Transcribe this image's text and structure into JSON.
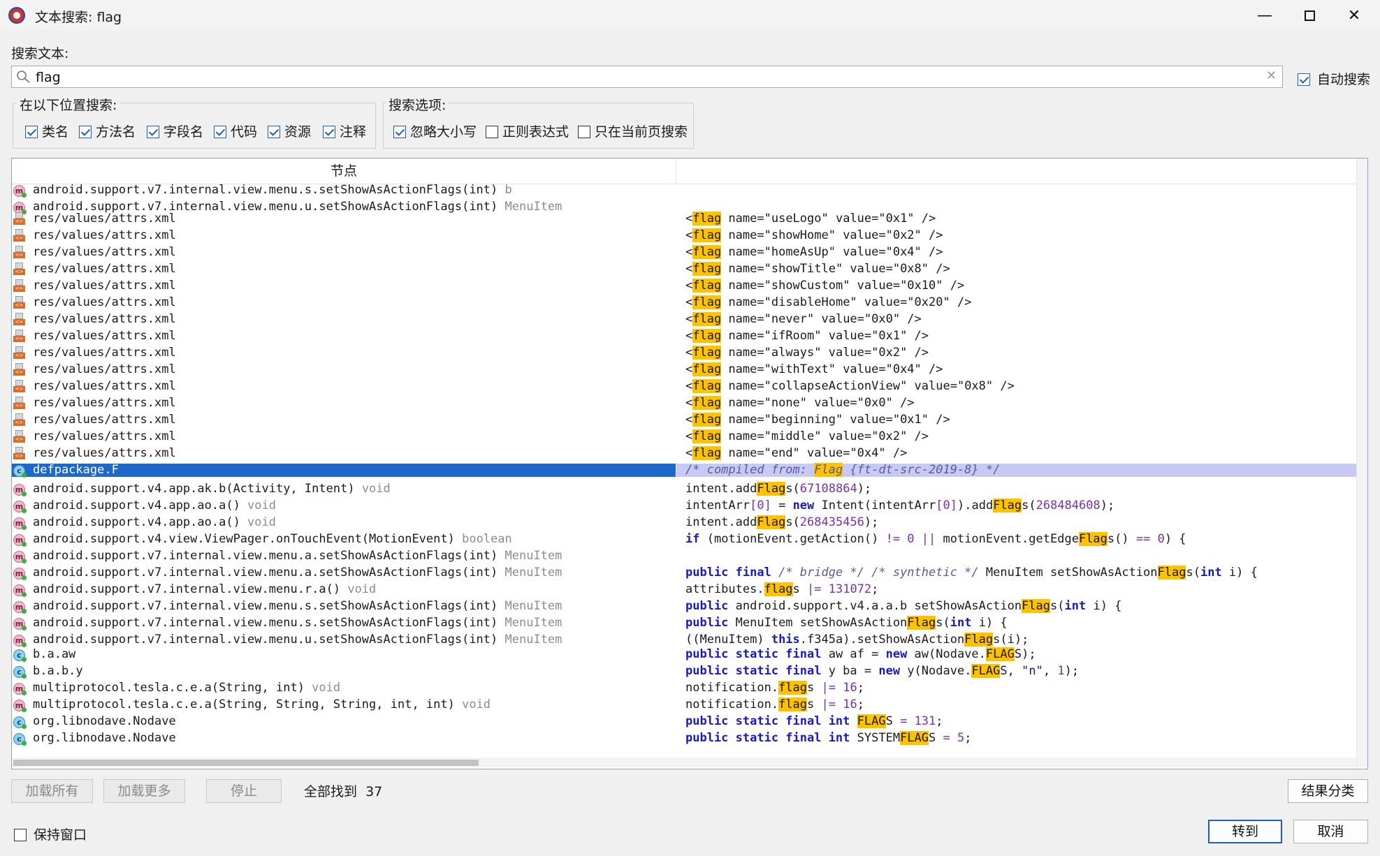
{
  "window": {
    "title": "文本搜索: flag"
  },
  "search": {
    "label": "搜索文本:",
    "value": "flag",
    "auto_search_label": "自动搜索",
    "auto_search_checked": true
  },
  "location_group": {
    "title": "在以下位置搜索:",
    "options": [
      {
        "label": "类名",
        "checked": true
      },
      {
        "label": "方法名",
        "checked": true
      },
      {
        "label": "字段名",
        "checked": true
      },
      {
        "label": "代码",
        "checked": true
      },
      {
        "label": "资源",
        "checked": true
      },
      {
        "label": "注释",
        "checked": true
      }
    ]
  },
  "search_options_group": {
    "title": "搜索选项:",
    "options": [
      {
        "label": "忽略大小写",
        "checked": true
      },
      {
        "label": "正则表达式",
        "checked": false
      },
      {
        "label": "只在当前页搜索",
        "checked": false
      }
    ]
  },
  "results": {
    "columns": [
      "节点",
      ""
    ],
    "rows": [
      {
        "icon": "method-icon",
        "node": "android.support.v7.internal.view.menu.s.setShowAsActionFlags(int)",
        "ret": "b",
        "code": []
      },
      {
        "icon": "method-icon",
        "node": "android.support.v7.internal.view.menu.u.setShowAsActionFlags(int)",
        "ret": "MenuItem",
        "code": []
      },
      {
        "icon": "xml-resource-icon",
        "node": "res/values/attrs.xml",
        "ret": "",
        "code": [
          [
            "t",
            "<"
          ],
          [
            "h",
            "flag"
          ],
          [
            "t",
            " name=\"useLogo\" value=\"0x1\" />"
          ]
        ]
      },
      {
        "icon": "xml-resource-icon",
        "node": "res/values/attrs.xml",
        "ret": "",
        "code": [
          [
            "t",
            "<"
          ],
          [
            "h",
            "flag"
          ],
          [
            "t",
            " name=\"showHome\" value=\"0x2\" />"
          ]
        ]
      },
      {
        "icon": "xml-resource-icon",
        "node": "res/values/attrs.xml",
        "ret": "",
        "code": [
          [
            "t",
            "<"
          ],
          [
            "h",
            "flag"
          ],
          [
            "t",
            " name=\"homeAsUp\" value=\"0x4\" />"
          ]
        ]
      },
      {
        "icon": "xml-resource-icon",
        "node": "res/values/attrs.xml",
        "ret": "",
        "code": [
          [
            "t",
            "<"
          ],
          [
            "h",
            "flag"
          ],
          [
            "t",
            " name=\"showTitle\" value=\"0x8\" />"
          ]
        ]
      },
      {
        "icon": "xml-resource-icon",
        "node": "res/values/attrs.xml",
        "ret": "",
        "code": [
          [
            "t",
            "<"
          ],
          [
            "h",
            "flag"
          ],
          [
            "t",
            " name=\"showCustom\" value=\"0x10\" />"
          ]
        ]
      },
      {
        "icon": "xml-resource-icon",
        "node": "res/values/attrs.xml",
        "ret": "",
        "code": [
          [
            "t",
            "<"
          ],
          [
            "h",
            "flag"
          ],
          [
            "t",
            " name=\"disableHome\" value=\"0x20\" />"
          ]
        ]
      },
      {
        "icon": "xml-resource-icon",
        "node": "res/values/attrs.xml",
        "ret": "",
        "code": [
          [
            "t",
            "<"
          ],
          [
            "h",
            "flag"
          ],
          [
            "t",
            " name=\"never\" value=\"0x0\" />"
          ]
        ]
      },
      {
        "icon": "xml-resource-icon",
        "node": "res/values/attrs.xml",
        "ret": "",
        "code": [
          [
            "t",
            "<"
          ],
          [
            "h",
            "flag"
          ],
          [
            "t",
            " name=\"ifRoom\" value=\"0x1\" />"
          ]
        ]
      },
      {
        "icon": "xml-resource-icon",
        "node": "res/values/attrs.xml",
        "ret": "",
        "code": [
          [
            "t",
            "<"
          ],
          [
            "h",
            "flag"
          ],
          [
            "t",
            " name=\"always\" value=\"0x2\" />"
          ]
        ]
      },
      {
        "icon": "xml-resource-icon",
        "node": "res/values/attrs.xml",
        "ret": "",
        "code": [
          [
            "t",
            "<"
          ],
          [
            "h",
            "flag"
          ],
          [
            "t",
            " name=\"withText\" value=\"0x4\" />"
          ]
        ]
      },
      {
        "icon": "xml-resource-icon",
        "node": "res/values/attrs.xml",
        "ret": "",
        "code": [
          [
            "t",
            "<"
          ],
          [
            "h",
            "flag"
          ],
          [
            "t",
            " name=\"collapseActionView\" value=\"0x8\" />"
          ]
        ]
      },
      {
        "icon": "xml-resource-icon",
        "node": "res/values/attrs.xml",
        "ret": "",
        "code": [
          [
            "t",
            "<"
          ],
          [
            "h",
            "flag"
          ],
          [
            "t",
            " name=\"none\" value=\"0x0\" />"
          ]
        ]
      },
      {
        "icon": "xml-resource-icon",
        "node": "res/values/attrs.xml",
        "ret": "",
        "code": [
          [
            "t",
            "<"
          ],
          [
            "h",
            "flag"
          ],
          [
            "t",
            " name=\"beginning\" value=\"0x1\" />"
          ]
        ]
      },
      {
        "icon": "xml-resource-icon",
        "node": "res/values/attrs.xml",
        "ret": "",
        "code": [
          [
            "t",
            "<"
          ],
          [
            "h",
            "flag"
          ],
          [
            "t",
            " name=\"middle\" value=\"0x2\" />"
          ]
        ]
      },
      {
        "icon": "xml-resource-icon",
        "node": "res/values/attrs.xml",
        "ret": "",
        "code": [
          [
            "t",
            "<"
          ],
          [
            "h",
            "flag"
          ],
          [
            "t",
            " name=\"end\" value=\"0x4\" />"
          ]
        ]
      },
      {
        "icon": "class-icon",
        "node": "defpackage.F",
        "ret": "",
        "selected": true,
        "code": [
          [
            "c",
            "/* compiled from: "
          ],
          [
            "hc",
            "Flag"
          ],
          [
            "c",
            " {ft-dt-src-2019-8} */"
          ]
        ]
      },
      {
        "icon": "method-icon",
        "node": "android.support.v4.app.ak.b(Activity, Intent)",
        "ret": "void",
        "code": [
          [
            "t",
            "intent.add"
          ],
          [
            "h",
            "Flag"
          ],
          [
            "t",
            "s("
          ],
          [
            "n",
            "67108864"
          ],
          [
            "t",
            ");"
          ]
        ]
      },
      {
        "icon": "method-icon",
        "node": "android.support.v4.app.ao.a()",
        "ret": "void",
        "code": [
          [
            "t",
            "intentArr"
          ],
          [
            "n",
            "[0]"
          ],
          [
            "t",
            " = "
          ],
          [
            "k",
            "new"
          ],
          [
            "t",
            " Intent(intentArr"
          ],
          [
            "n",
            "[0]"
          ],
          [
            "t",
            ").add"
          ],
          [
            "h",
            "Flag"
          ],
          [
            "t",
            "s("
          ],
          [
            "n",
            "268484608"
          ],
          [
            "t",
            ");"
          ]
        ]
      },
      {
        "icon": "method-icon",
        "node": "android.support.v4.app.ao.a()",
        "ret": "void",
        "code": [
          [
            "t",
            "intent.add"
          ],
          [
            "h",
            "Flag"
          ],
          [
            "t",
            "s("
          ],
          [
            "n",
            "268435456"
          ],
          [
            "t",
            ");"
          ]
        ]
      },
      {
        "icon": "method-icon",
        "node": "android.support.v4.view.ViewPager.onTouchEvent(MotionEvent)",
        "ret": "boolean",
        "code": [
          [
            "k",
            "if"
          ],
          [
            "t",
            " (motionEvent.getAction() "
          ],
          [
            "n",
            "!= 0 ||"
          ],
          [
            "t",
            " motionEvent.getEdge"
          ],
          [
            "h",
            "Flag"
          ],
          [
            "t",
            "s() "
          ],
          [
            "n",
            "== 0"
          ],
          [
            "t",
            ") {"
          ]
        ]
      },
      {
        "icon": "method-icon",
        "node": "android.support.v7.internal.view.menu.a.setShowAsActionFlags(int)",
        "ret": "MenuItem",
        "code": []
      },
      {
        "icon": "method-icon",
        "node": "android.support.v7.internal.view.menu.a.setShowAsActionFlags(int)",
        "ret": "MenuItem",
        "code": [
          [
            "k",
            "public final"
          ],
          [
            "t",
            " "
          ],
          [
            "c",
            "/* bridge */ /* synthetic */"
          ],
          [
            "t",
            " MenuItem setShowAsAction"
          ],
          [
            "h",
            "Flag"
          ],
          [
            "t",
            "s("
          ],
          [
            "k",
            "int"
          ],
          [
            "t",
            " i) {"
          ]
        ]
      },
      {
        "icon": "method-icon",
        "node": "android.support.v7.internal.view.menu.r.a()",
        "ret": "void",
        "code": [
          [
            "t",
            "attributes."
          ],
          [
            "h",
            "flag"
          ],
          [
            "t",
            "s "
          ],
          [
            "n",
            "|= 131072"
          ],
          [
            "t",
            ";"
          ]
        ]
      },
      {
        "icon": "method-icon",
        "node": "android.support.v7.internal.view.menu.s.setShowAsActionFlags(int)",
        "ret": "MenuItem",
        "code": [
          [
            "k",
            "public"
          ],
          [
            "t",
            " android.support.v4.a.a.b setShowAsAction"
          ],
          [
            "h",
            "Flag"
          ],
          [
            "t",
            "s("
          ],
          [
            "k",
            "int"
          ],
          [
            "t",
            " i) {"
          ]
        ]
      },
      {
        "icon": "method-icon",
        "node": "android.support.v7.internal.view.menu.s.setShowAsActionFlags(int)",
        "ret": "MenuItem",
        "code": [
          [
            "k",
            "public"
          ],
          [
            "t",
            " MenuItem setShowAsAction"
          ],
          [
            "h",
            "Flag"
          ],
          [
            "t",
            "s("
          ],
          [
            "k",
            "int"
          ],
          [
            "t",
            " i) {"
          ]
        ]
      },
      {
        "icon": "method-icon",
        "node": "android.support.v7.internal.view.menu.u.setShowAsActionFlags(int)",
        "ret": "MenuItem",
        "code": [
          [
            "t",
            "((MenuItem) "
          ],
          [
            "k",
            "this"
          ],
          [
            "t",
            ".f345a).setShowAsAction"
          ],
          [
            "h",
            "Flag"
          ],
          [
            "t",
            "s(i);"
          ]
        ]
      },
      {
        "icon": "class-icon",
        "node": "b.a.aw",
        "ret": "",
        "code": [
          [
            "k",
            "public static final"
          ],
          [
            "t",
            " aw af = "
          ],
          [
            "k",
            "new"
          ],
          [
            "t",
            " aw(Nodave."
          ],
          [
            "h",
            "FLAG"
          ],
          [
            "t",
            "S);"
          ]
        ]
      },
      {
        "icon": "class-icon",
        "node": "b.a.b.y",
        "ret": "",
        "code": [
          [
            "k",
            "public static final"
          ],
          [
            "t",
            " y ba = "
          ],
          [
            "k",
            "new"
          ],
          [
            "t",
            " y(Nodave."
          ],
          [
            "h",
            "FLAG"
          ],
          [
            "t",
            "S, "
          ],
          [
            "s",
            "\"n\""
          ],
          [
            "t",
            ", "
          ],
          [
            "n",
            "1"
          ],
          [
            "t",
            ");"
          ]
        ]
      },
      {
        "icon": "method-icon",
        "node": "multiprotocol.tesla.c.e.a(String, int)",
        "ret": "void",
        "code": [
          [
            "t",
            "notification."
          ],
          [
            "h",
            "flag"
          ],
          [
            "t",
            "s "
          ],
          [
            "n",
            "|= 16"
          ],
          [
            "t",
            ";"
          ]
        ]
      },
      {
        "icon": "method-icon",
        "node": "multiprotocol.tesla.c.e.a(String, String, String, int, int)",
        "ret": "void",
        "code": [
          [
            "t",
            "notification."
          ],
          [
            "h",
            "flag"
          ],
          [
            "t",
            "s "
          ],
          [
            "n",
            "|= 16"
          ],
          [
            "t",
            ";"
          ]
        ]
      },
      {
        "icon": "class-icon",
        "node": "org.libnodave.Nodave",
        "ret": "",
        "code": [
          [
            "k",
            "public static final int"
          ],
          [
            "t",
            " "
          ],
          [
            "h",
            "FLAG"
          ],
          [
            "t",
            "S "
          ],
          [
            "n",
            "= 131"
          ],
          [
            "t",
            ";"
          ]
        ]
      },
      {
        "icon": "class-icon",
        "node": "org.libnodave.Nodave",
        "ret": "",
        "code": [
          [
            "k",
            "public static final int"
          ],
          [
            "t",
            " SYSTEM"
          ],
          [
            "h",
            "FLAG"
          ],
          [
            "t",
            "S "
          ],
          [
            "n",
            "= 5"
          ],
          [
            "t",
            ";"
          ]
        ]
      }
    ]
  },
  "footer": {
    "load_all": "加载所有",
    "load_more": "加载更多",
    "stop": "停止",
    "found_text": "全部找到  37",
    "categorize": "结果分类",
    "keep_window": "保持窗口",
    "goto": "转到",
    "cancel": "取消"
  }
}
